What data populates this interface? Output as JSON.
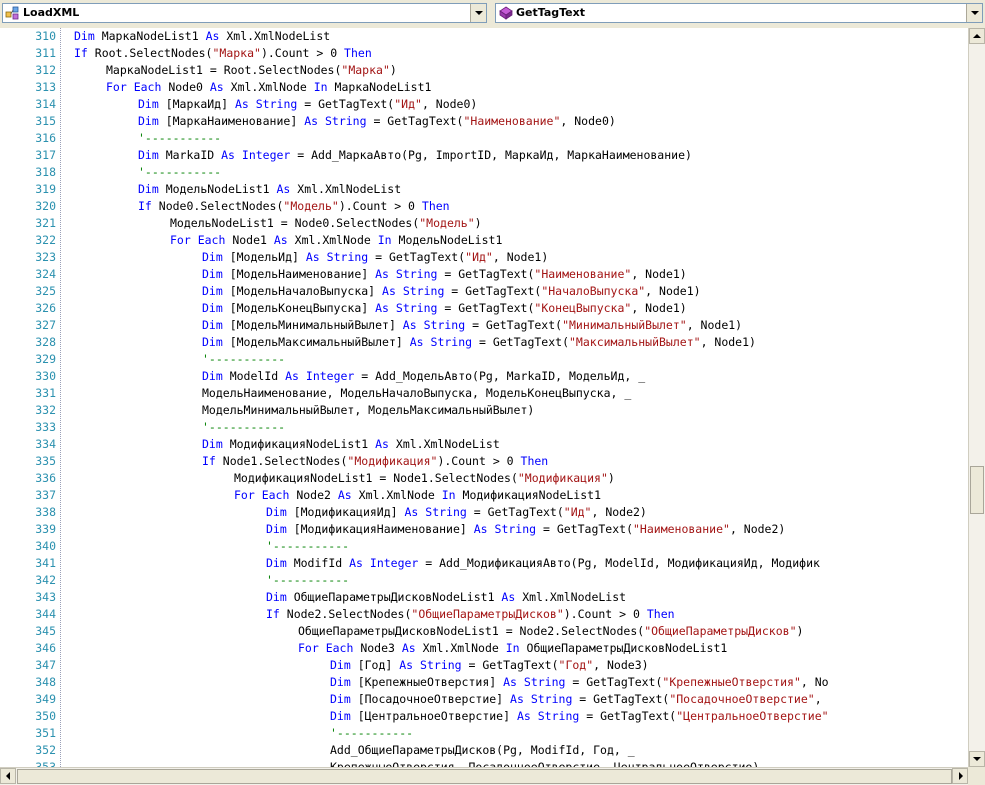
{
  "header": {
    "left_combo": {
      "label": "LoadXML",
      "icon": "class-icon"
    },
    "right_combo": {
      "label": "GetTagText",
      "icon": "method-icon"
    }
  },
  "colors": {
    "keyword": "#0000ff",
    "string": "#a31515",
    "comment": "#008000",
    "line_number": "#2b91af"
  },
  "editor": {
    "lines": [
      {
        "n": "310",
        "i": 8,
        "t": [
          [
            "k",
            "Dim"
          ],
          [
            "p",
            " МаркаNodeList1 "
          ],
          [
            "k",
            "As"
          ],
          [
            "p",
            " Xml.XmlNodeList"
          ]
        ]
      },
      {
        "n": "311",
        "i": 8,
        "t": [
          [
            "k",
            "If"
          ],
          [
            "p",
            " Root.SelectNodes("
          ],
          [
            "s",
            "\"Марка\""
          ],
          [
            "p",
            ").Count > 0 "
          ],
          [
            "k",
            "Then"
          ]
        ]
      },
      {
        "n": "312",
        "i": 12,
        "t": [
          [
            "p",
            "МаркаNodeList1 = Root.SelectNodes("
          ],
          [
            "s",
            "\"Марка\""
          ],
          [
            "p",
            ")"
          ]
        ]
      },
      {
        "n": "313",
        "i": 12,
        "t": [
          [
            "k",
            "For Each"
          ],
          [
            "p",
            " Node0 "
          ],
          [
            "k",
            "As"
          ],
          [
            "p",
            " Xml.XmlNode "
          ],
          [
            "k",
            "In"
          ],
          [
            "p",
            " МаркаNodeList1"
          ]
        ]
      },
      {
        "n": "314",
        "i": 16,
        "t": [
          [
            "k",
            "Dim"
          ],
          [
            "p",
            " [МаркаИд] "
          ],
          [
            "k",
            "As"
          ],
          [
            "p",
            " "
          ],
          [
            "k",
            "String"
          ],
          [
            "p",
            " = GetTagText("
          ],
          [
            "s",
            "\"Ид\""
          ],
          [
            "p",
            ", Node0)"
          ]
        ]
      },
      {
        "n": "315",
        "i": 16,
        "t": [
          [
            "k",
            "Dim"
          ],
          [
            "p",
            " [МаркаНаименование] "
          ],
          [
            "k",
            "As"
          ],
          [
            "p",
            " "
          ],
          [
            "k",
            "String"
          ],
          [
            "p",
            " = GetTagText("
          ],
          [
            "s",
            "\"Наименование\""
          ],
          [
            "p",
            ", Node0)"
          ]
        ]
      },
      {
        "n": "316",
        "i": 16,
        "t": [
          [
            "c",
            "'-----------"
          ]
        ]
      },
      {
        "n": "317",
        "i": 16,
        "t": [
          [
            "k",
            "Dim"
          ],
          [
            "p",
            " MarkaID "
          ],
          [
            "k",
            "As"
          ],
          [
            "p",
            " "
          ],
          [
            "k",
            "Integer"
          ],
          [
            "p",
            " = Add_МаркаАвто(Pg, ImportID, МаркаИд, МаркаНаименование)"
          ]
        ]
      },
      {
        "n": "318",
        "i": 16,
        "t": [
          [
            "c",
            "'-----------"
          ]
        ]
      },
      {
        "n": "319",
        "i": 16,
        "t": [
          [
            "k",
            "Dim"
          ],
          [
            "p",
            " МодельNodeList1 "
          ],
          [
            "k",
            "As"
          ],
          [
            "p",
            " Xml.XmlNodeList"
          ]
        ]
      },
      {
        "n": "320",
        "i": 16,
        "t": [
          [
            "k",
            "If"
          ],
          [
            "p",
            " Node0.SelectNodes("
          ],
          [
            "s",
            "\"Модель\""
          ],
          [
            "p",
            ").Count > 0 "
          ],
          [
            "k",
            "Then"
          ]
        ]
      },
      {
        "n": "321",
        "i": 20,
        "t": [
          [
            "p",
            "МодельNodeList1 = Node0.SelectNodes("
          ],
          [
            "s",
            "\"Модель\""
          ],
          [
            "p",
            ")"
          ]
        ]
      },
      {
        "n": "322",
        "i": 20,
        "t": [
          [
            "k",
            "For Each"
          ],
          [
            "p",
            " Node1 "
          ],
          [
            "k",
            "As"
          ],
          [
            "p",
            " Xml.XmlNode "
          ],
          [
            "k",
            "In"
          ],
          [
            "p",
            " МодельNodeList1"
          ]
        ]
      },
      {
        "n": "323",
        "i": 24,
        "t": [
          [
            "k",
            "Dim"
          ],
          [
            "p",
            " [МодельИд] "
          ],
          [
            "k",
            "As"
          ],
          [
            "p",
            " "
          ],
          [
            "k",
            "String"
          ],
          [
            "p",
            " = GetTagText("
          ],
          [
            "s",
            "\"Ид\""
          ],
          [
            "p",
            ", Node1)"
          ]
        ]
      },
      {
        "n": "324",
        "i": 24,
        "t": [
          [
            "k",
            "Dim"
          ],
          [
            "p",
            " [МодельНаименование] "
          ],
          [
            "k",
            "As"
          ],
          [
            "p",
            " "
          ],
          [
            "k",
            "String"
          ],
          [
            "p",
            " = GetTagText("
          ],
          [
            "s",
            "\"Наименование\""
          ],
          [
            "p",
            ", Node1)"
          ]
        ]
      },
      {
        "n": "325",
        "i": 24,
        "t": [
          [
            "k",
            "Dim"
          ],
          [
            "p",
            " [МодельНачалоВыпуска] "
          ],
          [
            "k",
            "As"
          ],
          [
            "p",
            " "
          ],
          [
            "k",
            "String"
          ],
          [
            "p",
            " = GetTagText("
          ],
          [
            "s",
            "\"НачалоВыпуска\""
          ],
          [
            "p",
            ", Node1)"
          ]
        ]
      },
      {
        "n": "326",
        "i": 24,
        "t": [
          [
            "k",
            "Dim"
          ],
          [
            "p",
            " [МодельКонецВыпуска] "
          ],
          [
            "k",
            "As"
          ],
          [
            "p",
            " "
          ],
          [
            "k",
            "String"
          ],
          [
            "p",
            " = GetTagText("
          ],
          [
            "s",
            "\"КонецВыпуска\""
          ],
          [
            "p",
            ", Node1)"
          ]
        ]
      },
      {
        "n": "327",
        "i": 24,
        "t": [
          [
            "k",
            "Dim"
          ],
          [
            "p",
            " [МодельМинимальныйВылет] "
          ],
          [
            "k",
            "As"
          ],
          [
            "p",
            " "
          ],
          [
            "k",
            "String"
          ],
          [
            "p",
            " = GetTagText("
          ],
          [
            "s",
            "\"МинимальныйВылет\""
          ],
          [
            "p",
            ", Node1)"
          ]
        ]
      },
      {
        "n": "328",
        "i": 24,
        "t": [
          [
            "k",
            "Dim"
          ],
          [
            "p",
            " [МодельМаксимальныйВылет] "
          ],
          [
            "k",
            "As"
          ],
          [
            "p",
            " "
          ],
          [
            "k",
            "String"
          ],
          [
            "p",
            " = GetTagText("
          ],
          [
            "s",
            "\"МаксимальныйВылет\""
          ],
          [
            "p",
            ", Node1)"
          ]
        ]
      },
      {
        "n": "329",
        "i": 24,
        "t": [
          [
            "c",
            "'-----------"
          ]
        ]
      },
      {
        "n": "330",
        "i": 24,
        "t": [
          [
            "k",
            "Dim"
          ],
          [
            "p",
            " ModelId "
          ],
          [
            "k",
            "As"
          ],
          [
            "p",
            " "
          ],
          [
            "k",
            "Integer"
          ],
          [
            "p",
            " = Add_МодельАвто(Pg, MarkaID, МодельИд, _"
          ]
        ]
      },
      {
        "n": "331",
        "i": 24,
        "t": [
          [
            "p",
            "МодельНаименование, МодельНачалоВыпуска, МодельКонецВыпуска, _"
          ]
        ]
      },
      {
        "n": "332",
        "i": 24,
        "t": [
          [
            "p",
            "МодельМинимальныйВылет, МодельМаксимальныйВылет)"
          ]
        ]
      },
      {
        "n": "333",
        "i": 24,
        "t": [
          [
            "c",
            "'-----------"
          ]
        ]
      },
      {
        "n": "334",
        "i": 24,
        "t": [
          [
            "k",
            "Dim"
          ],
          [
            "p",
            " МодификацияNodeList1 "
          ],
          [
            "k",
            "As"
          ],
          [
            "p",
            " Xml.XmlNodeList"
          ]
        ]
      },
      {
        "n": "335",
        "i": 24,
        "t": [
          [
            "k",
            "If"
          ],
          [
            "p",
            " Node1.SelectNodes("
          ],
          [
            "s",
            "\"Модификация\""
          ],
          [
            "p",
            ").Count > 0 "
          ],
          [
            "k",
            "Then"
          ]
        ]
      },
      {
        "n": "336",
        "i": 28,
        "t": [
          [
            "p",
            "МодификацияNodeList1 = Node1.SelectNodes("
          ],
          [
            "s",
            "\"Модификация\""
          ],
          [
            "p",
            ")"
          ]
        ]
      },
      {
        "n": "337",
        "i": 28,
        "t": [
          [
            "k",
            "For Each"
          ],
          [
            "p",
            " Node2 "
          ],
          [
            "k",
            "As"
          ],
          [
            "p",
            " Xml.XmlNode "
          ],
          [
            "k",
            "In"
          ],
          [
            "p",
            " МодификацияNodeList1"
          ]
        ]
      },
      {
        "n": "338",
        "i": 32,
        "t": [
          [
            "k",
            "Dim"
          ],
          [
            "p",
            " [МодификацияИд] "
          ],
          [
            "k",
            "As"
          ],
          [
            "p",
            " "
          ],
          [
            "k",
            "String"
          ],
          [
            "p",
            " = GetTagText("
          ],
          [
            "s",
            "\"Ид\""
          ],
          [
            "p",
            ", Node2)"
          ]
        ]
      },
      {
        "n": "339",
        "i": 32,
        "t": [
          [
            "k",
            "Dim"
          ],
          [
            "p",
            " [МодификацияНаименование] "
          ],
          [
            "k",
            "As"
          ],
          [
            "p",
            " "
          ],
          [
            "k",
            "String"
          ],
          [
            "p",
            " = GetTagText("
          ],
          [
            "s",
            "\"Наименование\""
          ],
          [
            "p",
            ", Node2)"
          ]
        ]
      },
      {
        "n": "340",
        "i": 32,
        "t": [
          [
            "c",
            "'-----------"
          ]
        ]
      },
      {
        "n": "341",
        "i": 32,
        "t": [
          [
            "k",
            "Dim"
          ],
          [
            "p",
            " ModifId "
          ],
          [
            "k",
            "As"
          ],
          [
            "p",
            " "
          ],
          [
            "k",
            "Integer"
          ],
          [
            "p",
            " = Add_МодификацияАвто(Pg, ModelId, МодификацияИд, Модифик"
          ]
        ]
      },
      {
        "n": "342",
        "i": 32,
        "t": [
          [
            "c",
            "'-----------"
          ]
        ]
      },
      {
        "n": "343",
        "i": 32,
        "t": [
          [
            "k",
            "Dim"
          ],
          [
            "p",
            " ОбщиеПараметрыДисковNodeList1 "
          ],
          [
            "k",
            "As"
          ],
          [
            "p",
            " Xml.XmlNodeList"
          ]
        ]
      },
      {
        "n": "344",
        "i": 32,
        "t": [
          [
            "k",
            "If"
          ],
          [
            "p",
            " Node2.SelectNodes("
          ],
          [
            "s",
            "\"ОбщиеПараметрыДисков\""
          ],
          [
            "p",
            ").Count > 0 "
          ],
          [
            "k",
            "Then"
          ]
        ]
      },
      {
        "n": "345",
        "i": 36,
        "t": [
          [
            "p",
            "ОбщиеПараметрыДисковNodeList1 = Node2.SelectNodes("
          ],
          [
            "s",
            "\"ОбщиеПараметрыДисков\""
          ],
          [
            "p",
            ")"
          ]
        ]
      },
      {
        "n": "346",
        "i": 36,
        "t": [
          [
            "k",
            "For Each"
          ],
          [
            "p",
            " Node3 "
          ],
          [
            "k",
            "As"
          ],
          [
            "p",
            " Xml.XmlNode "
          ],
          [
            "k",
            "In"
          ],
          [
            "p",
            " ОбщиеПараметрыДисковNodeList1"
          ]
        ]
      },
      {
        "n": "347",
        "i": 40,
        "t": [
          [
            "k",
            "Dim"
          ],
          [
            "p",
            " [Год] "
          ],
          [
            "k",
            "As"
          ],
          [
            "p",
            " "
          ],
          [
            "k",
            "String"
          ],
          [
            "p",
            " = GetTagText("
          ],
          [
            "s",
            "\"Год\""
          ],
          [
            "p",
            ", Node3)"
          ]
        ]
      },
      {
        "n": "348",
        "i": 40,
        "t": [
          [
            "k",
            "Dim"
          ],
          [
            "p",
            " [КрепежныеОтверстия] "
          ],
          [
            "k",
            "As"
          ],
          [
            "p",
            " "
          ],
          [
            "k",
            "String"
          ],
          [
            "p",
            " = GetTagText("
          ],
          [
            "s",
            "\"КрепежныеОтверстия\""
          ],
          [
            "p",
            ", No"
          ]
        ]
      },
      {
        "n": "349",
        "i": 40,
        "t": [
          [
            "k",
            "Dim"
          ],
          [
            "p",
            " [ПосадочноеОтверстие] "
          ],
          [
            "k",
            "As"
          ],
          [
            "p",
            " "
          ],
          [
            "k",
            "String"
          ],
          [
            "p",
            " = GetTagText("
          ],
          [
            "s",
            "\"ПосадочноеОтверстие\""
          ],
          [
            "p",
            ","
          ]
        ]
      },
      {
        "n": "350",
        "i": 40,
        "t": [
          [
            "k",
            "Dim"
          ],
          [
            "p",
            " [ЦентральноеОтверстие] "
          ],
          [
            "k",
            "As"
          ],
          [
            "p",
            " "
          ],
          [
            "k",
            "String"
          ],
          [
            "p",
            " = GetTagText("
          ],
          [
            "s",
            "\"ЦентральноеОтверстие\""
          ]
        ]
      },
      {
        "n": "351",
        "i": 40,
        "t": [
          [
            "c",
            "'-----------"
          ]
        ]
      },
      {
        "n": "352",
        "i": 40,
        "t": [
          [
            "p",
            "Add_ОбщиеПараметрыДисков(Pg, ModifId, Год, _"
          ]
        ]
      },
      {
        "n": "353",
        "i": 40,
        "t": [
          [
            "p",
            "КрепежныеОтверстия, ПосадочноеОтверстие, ЦентральноеОтверстие)"
          ]
        ]
      }
    ]
  }
}
